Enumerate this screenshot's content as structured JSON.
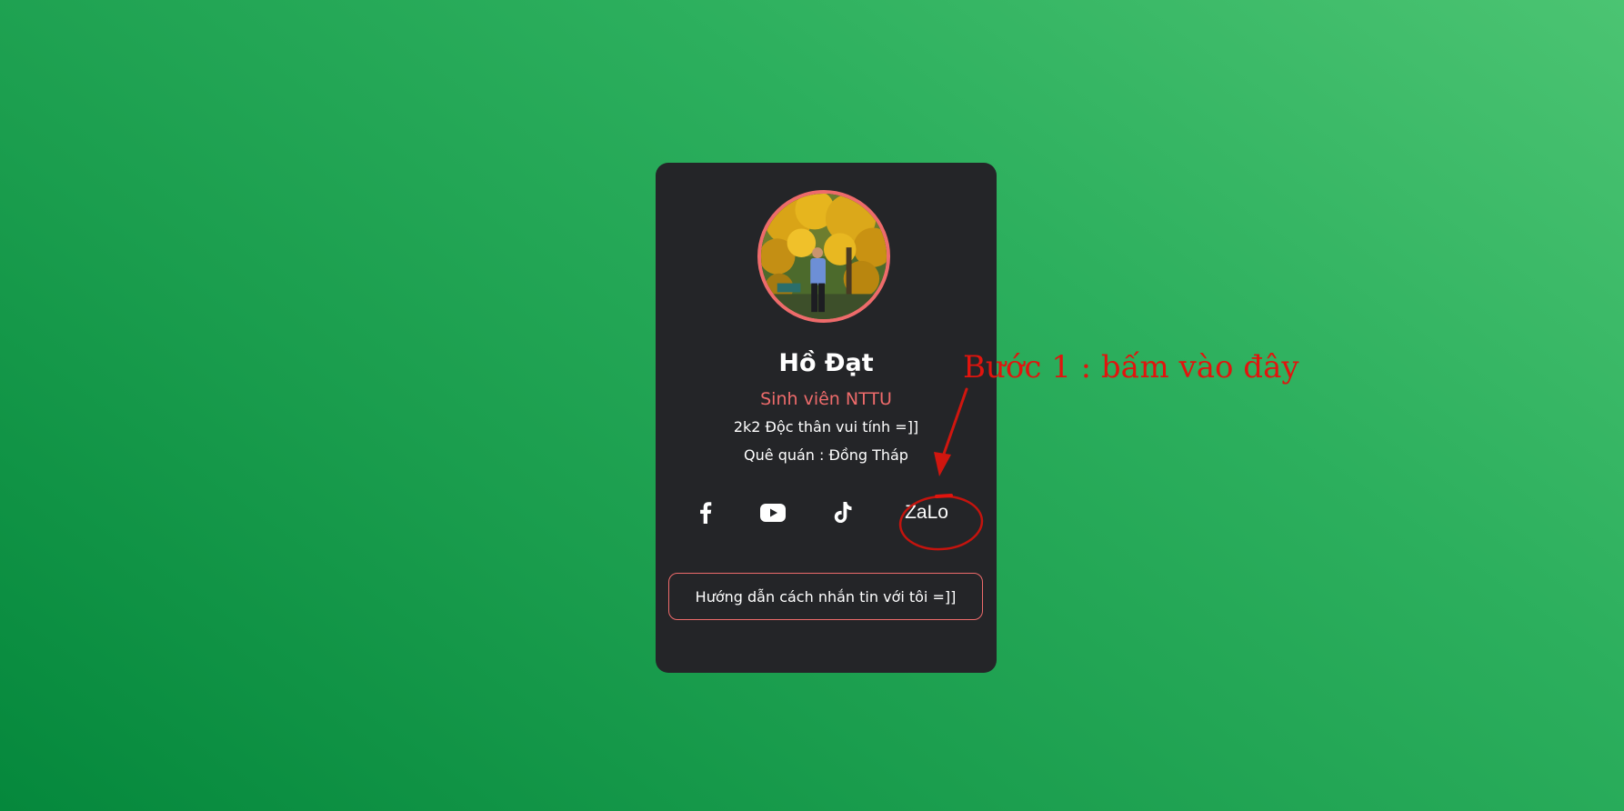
{
  "profile": {
    "name": "Hồ Đạt",
    "role": "Sinh viên NTTU",
    "bio_line_1": "2k2 Độc thân vui tính =]]",
    "bio_line_2": "Quê quán : Đồng Tháp"
  },
  "socials": {
    "facebook_icon": "facebook-icon",
    "youtube_icon": "youtube-icon",
    "tiktok_icon": "tiktok-icon",
    "zalo_label": "ZaLo"
  },
  "guide_button": {
    "label": "Hướng dẫn cách nhắn tin với tôi =]]"
  },
  "annotation": {
    "text": "Bước 1 : bấm vào đây",
    "color": "#e1140e"
  },
  "colors": {
    "accent": "#ee6b6b",
    "card_bg": "#242528",
    "background_start": "#05883c",
    "background_end": "#4bc472"
  }
}
